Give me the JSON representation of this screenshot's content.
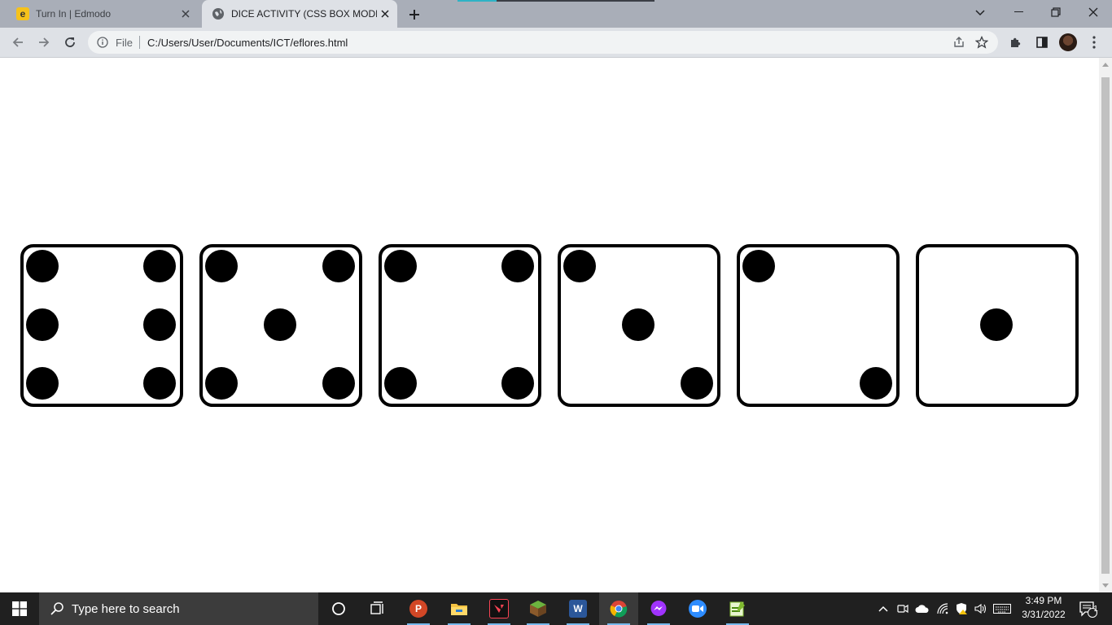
{
  "browser": {
    "tabs": [
      {
        "title": "Turn In | Edmodo",
        "icon": "edmodo-icon",
        "active": false
      },
      {
        "title": "DICE ACTIVITY (CSS BOX MODEL",
        "icon": "globe-icon",
        "active": true
      }
    ],
    "omnibox": {
      "scheme_label": "File",
      "url": "C:/Users/User/Documents/ICT/eflores.html"
    }
  },
  "page": {
    "dice": [
      {
        "face": 6
      },
      {
        "face": 5
      },
      {
        "face": 4
      },
      {
        "face": 3
      },
      {
        "face": 2
      },
      {
        "face": 1
      }
    ]
  },
  "taskbar": {
    "search_placeholder": "Type here to search",
    "apps": [
      "task-view-icon",
      "powerpoint-icon",
      "file-explorer-icon",
      "valorant-icon",
      "minecraft-icon",
      "word-icon",
      "chrome-icon",
      "messenger-icon",
      "zoom-icon",
      "notepad-plus-icon"
    ],
    "clock": {
      "time": "3:49 PM",
      "date": "3/31/2022"
    },
    "notification_count": "1"
  },
  "colors": {
    "tabstrip": "#a9aeb8",
    "toolbar": "#dee1e6",
    "taskbar": "#202020",
    "die_border": "#000000",
    "pip": "#000000"
  }
}
